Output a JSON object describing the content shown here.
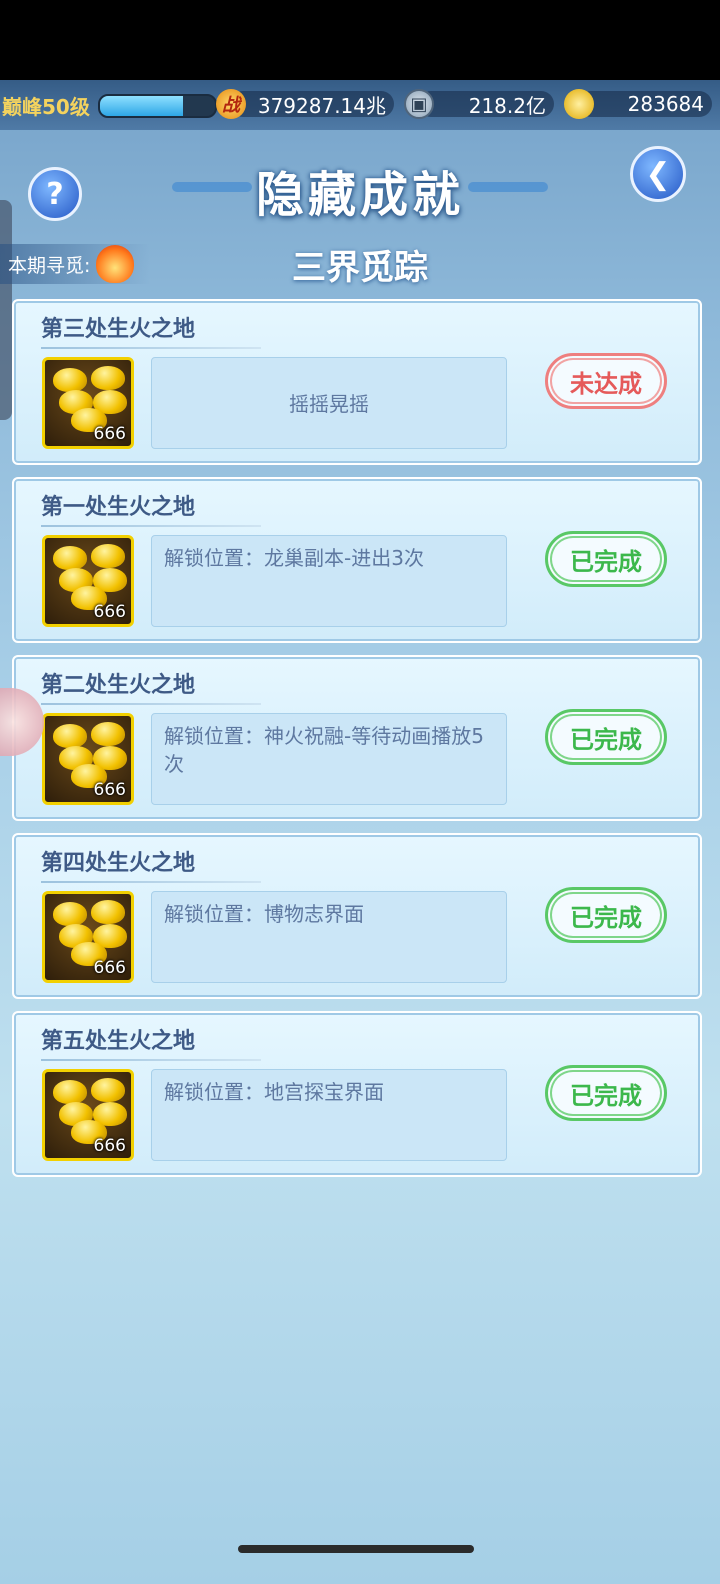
{
  "topbar": {
    "level": "巅峰50级",
    "xp_fraction": 0.72,
    "power_icon_glyph": "战",
    "power": "379287.14兆",
    "coin": "218.2亿",
    "gold": "283684"
  },
  "header": {
    "title": "隐藏成就",
    "period_label": "本期寻觅:",
    "subtitle": "三界觅踪",
    "help_glyph": "?",
    "back_glyph": "❮"
  },
  "achievements": [
    {
      "name": "第三处生火之地",
      "qty": "666",
      "desc": "摇摇晃摇",
      "status": "未达成",
      "done": false
    },
    {
      "name": "第一处生火之地",
      "qty": "666",
      "desc": "解锁位置：龙巢副本-进出3次",
      "status": "已完成",
      "done": true
    },
    {
      "name": "第二处生火之地",
      "qty": "666",
      "desc": "解锁位置：神火祝融-等待动画播放5次",
      "status": "已完成",
      "done": true
    },
    {
      "name": "第四处生火之地",
      "qty": "666",
      "desc": "解锁位置：博物志界面",
      "status": "已完成",
      "done": true
    },
    {
      "name": "第五处生火之地",
      "qty": "666",
      "desc": "解锁位置：地宫探宝界面",
      "status": "已完成",
      "done": true
    }
  ],
  "colors": {
    "done": "#3cb84c",
    "not_done": "#e55a5a",
    "title_text": "#3e5a86"
  }
}
